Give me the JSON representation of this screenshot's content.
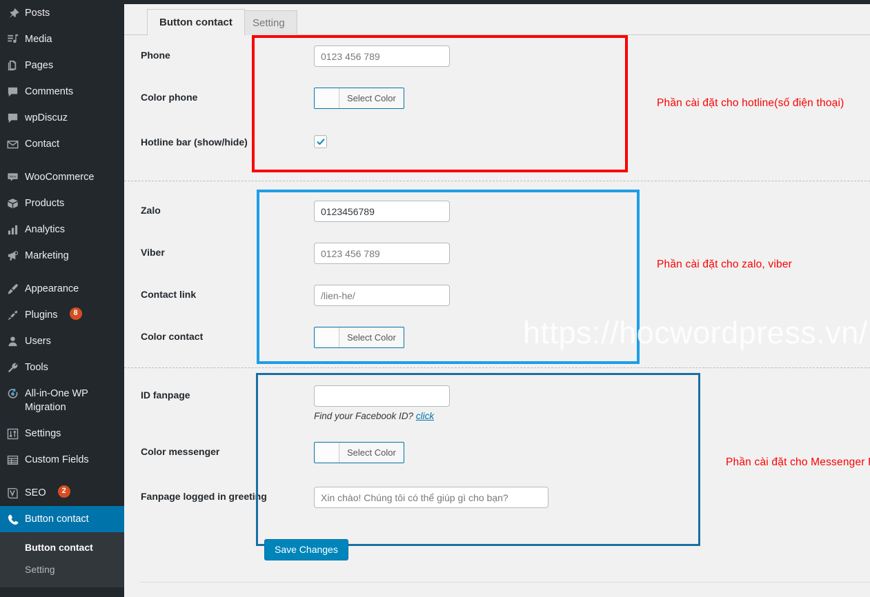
{
  "sidebar": {
    "items": [
      {
        "label": "Posts",
        "icon": "pin-icon",
        "badge": null,
        "active": false
      },
      {
        "label": "Media",
        "icon": "media-icon",
        "badge": null,
        "active": false
      },
      {
        "label": "Pages",
        "icon": "pages-icon",
        "badge": null,
        "active": false
      },
      {
        "label": "Comments",
        "icon": "comment-icon",
        "badge": null,
        "active": false
      },
      {
        "label": "wpDiscuz",
        "icon": "comment-icon",
        "badge": null,
        "active": false
      },
      {
        "label": "Contact",
        "icon": "envelope-icon",
        "badge": null,
        "active": false
      },
      {
        "label": "WooCommerce",
        "icon": "woo-icon",
        "badge": null,
        "active": false,
        "gap_before": true
      },
      {
        "label": "Products",
        "icon": "box-icon",
        "badge": null,
        "active": false
      },
      {
        "label": "Analytics",
        "icon": "bar-chart-icon",
        "badge": null,
        "active": false
      },
      {
        "label": "Marketing",
        "icon": "megaphone-icon",
        "badge": null,
        "active": false
      },
      {
        "label": "Appearance",
        "icon": "paintbrush-icon",
        "badge": null,
        "active": false,
        "gap_before": true
      },
      {
        "label": "Plugins",
        "icon": "plug-icon",
        "badge": "8",
        "active": false
      },
      {
        "label": "Users",
        "icon": "user-icon",
        "badge": null,
        "active": false
      },
      {
        "label": "Tools",
        "icon": "wrench-icon",
        "badge": null,
        "active": false
      },
      {
        "label": "All-in-One WP Migration",
        "icon": "migration-icon",
        "badge": null,
        "active": false
      },
      {
        "label": "Settings",
        "icon": "sliders-icon",
        "badge": null,
        "active": false
      },
      {
        "label": "Custom Fields",
        "icon": "table-icon",
        "badge": null,
        "active": false
      },
      {
        "label": "SEO",
        "icon": "yoast-icon",
        "badge": "2",
        "active": false,
        "gap_before": true
      },
      {
        "label": "Button contact",
        "icon": "phone-icon",
        "badge": null,
        "active": true
      }
    ],
    "submenu": [
      {
        "label": "Button contact",
        "current": true
      },
      {
        "label": "Setting",
        "current": false
      }
    ]
  },
  "tabs": [
    {
      "label": "Button contact",
      "active": true
    },
    {
      "label": "Setting",
      "active": false
    }
  ],
  "sections": {
    "hotline": {
      "border_color": "#fb0000",
      "annotation": "Phần cài đặt cho hotline(số điện thoại)",
      "fields": [
        {
          "label": "Phone",
          "type": "text",
          "value": "",
          "placeholder": "0123 456 789"
        },
        {
          "label": "Color phone",
          "type": "color",
          "button_label": "Select Color",
          "swatch": "#fcfcfc"
        },
        {
          "label": "Hotline bar (show/hide)",
          "type": "checkbox",
          "checked": true
        }
      ]
    },
    "zalo_viber": {
      "border_color": "#1e9de8",
      "annotation": "Phần cài đặt cho zalo, viber",
      "fields": [
        {
          "label": "Zalo",
          "type": "text",
          "value": "0123456789",
          "placeholder": ""
        },
        {
          "label": "Viber",
          "type": "text",
          "value": "",
          "placeholder": "0123 456 789"
        },
        {
          "label": "Contact link",
          "type": "text",
          "value": "",
          "placeholder": "/lien-he/"
        },
        {
          "label": "Color contact",
          "type": "color",
          "button_label": "Select Color",
          "swatch": "#fcfcfc"
        }
      ]
    },
    "messenger": {
      "border_color": "#1a6ea5",
      "annotation": "Phần cài đặt cho Messenger Facebook",
      "fields": [
        {
          "label": "ID fanpage",
          "type": "text",
          "value": "",
          "placeholder": "",
          "hint_text": "Find your Facebook ID?",
          "hint_link": "click"
        },
        {
          "label": "Color messenger",
          "type": "color",
          "button_label": "Select Color",
          "swatch": "#fcfcfc"
        },
        {
          "label": "Fanpage logged in greeting",
          "type": "text",
          "value": "",
          "placeholder": "Xin chào! Chúng tôi có thể giúp gì cho bạn?"
        }
      ]
    }
  },
  "footer": {
    "save_label": "Save Changes"
  },
  "watermark": "https://hocwordpress.vn/",
  "colors": {
    "sidebar_bg": "#23282d",
    "sidebar_active": "#0073aa",
    "badge": "#d54e21",
    "accent_button": "#0085ba",
    "annotation_red": "#fc0000",
    "page_bg": "#f1f1f1"
  }
}
